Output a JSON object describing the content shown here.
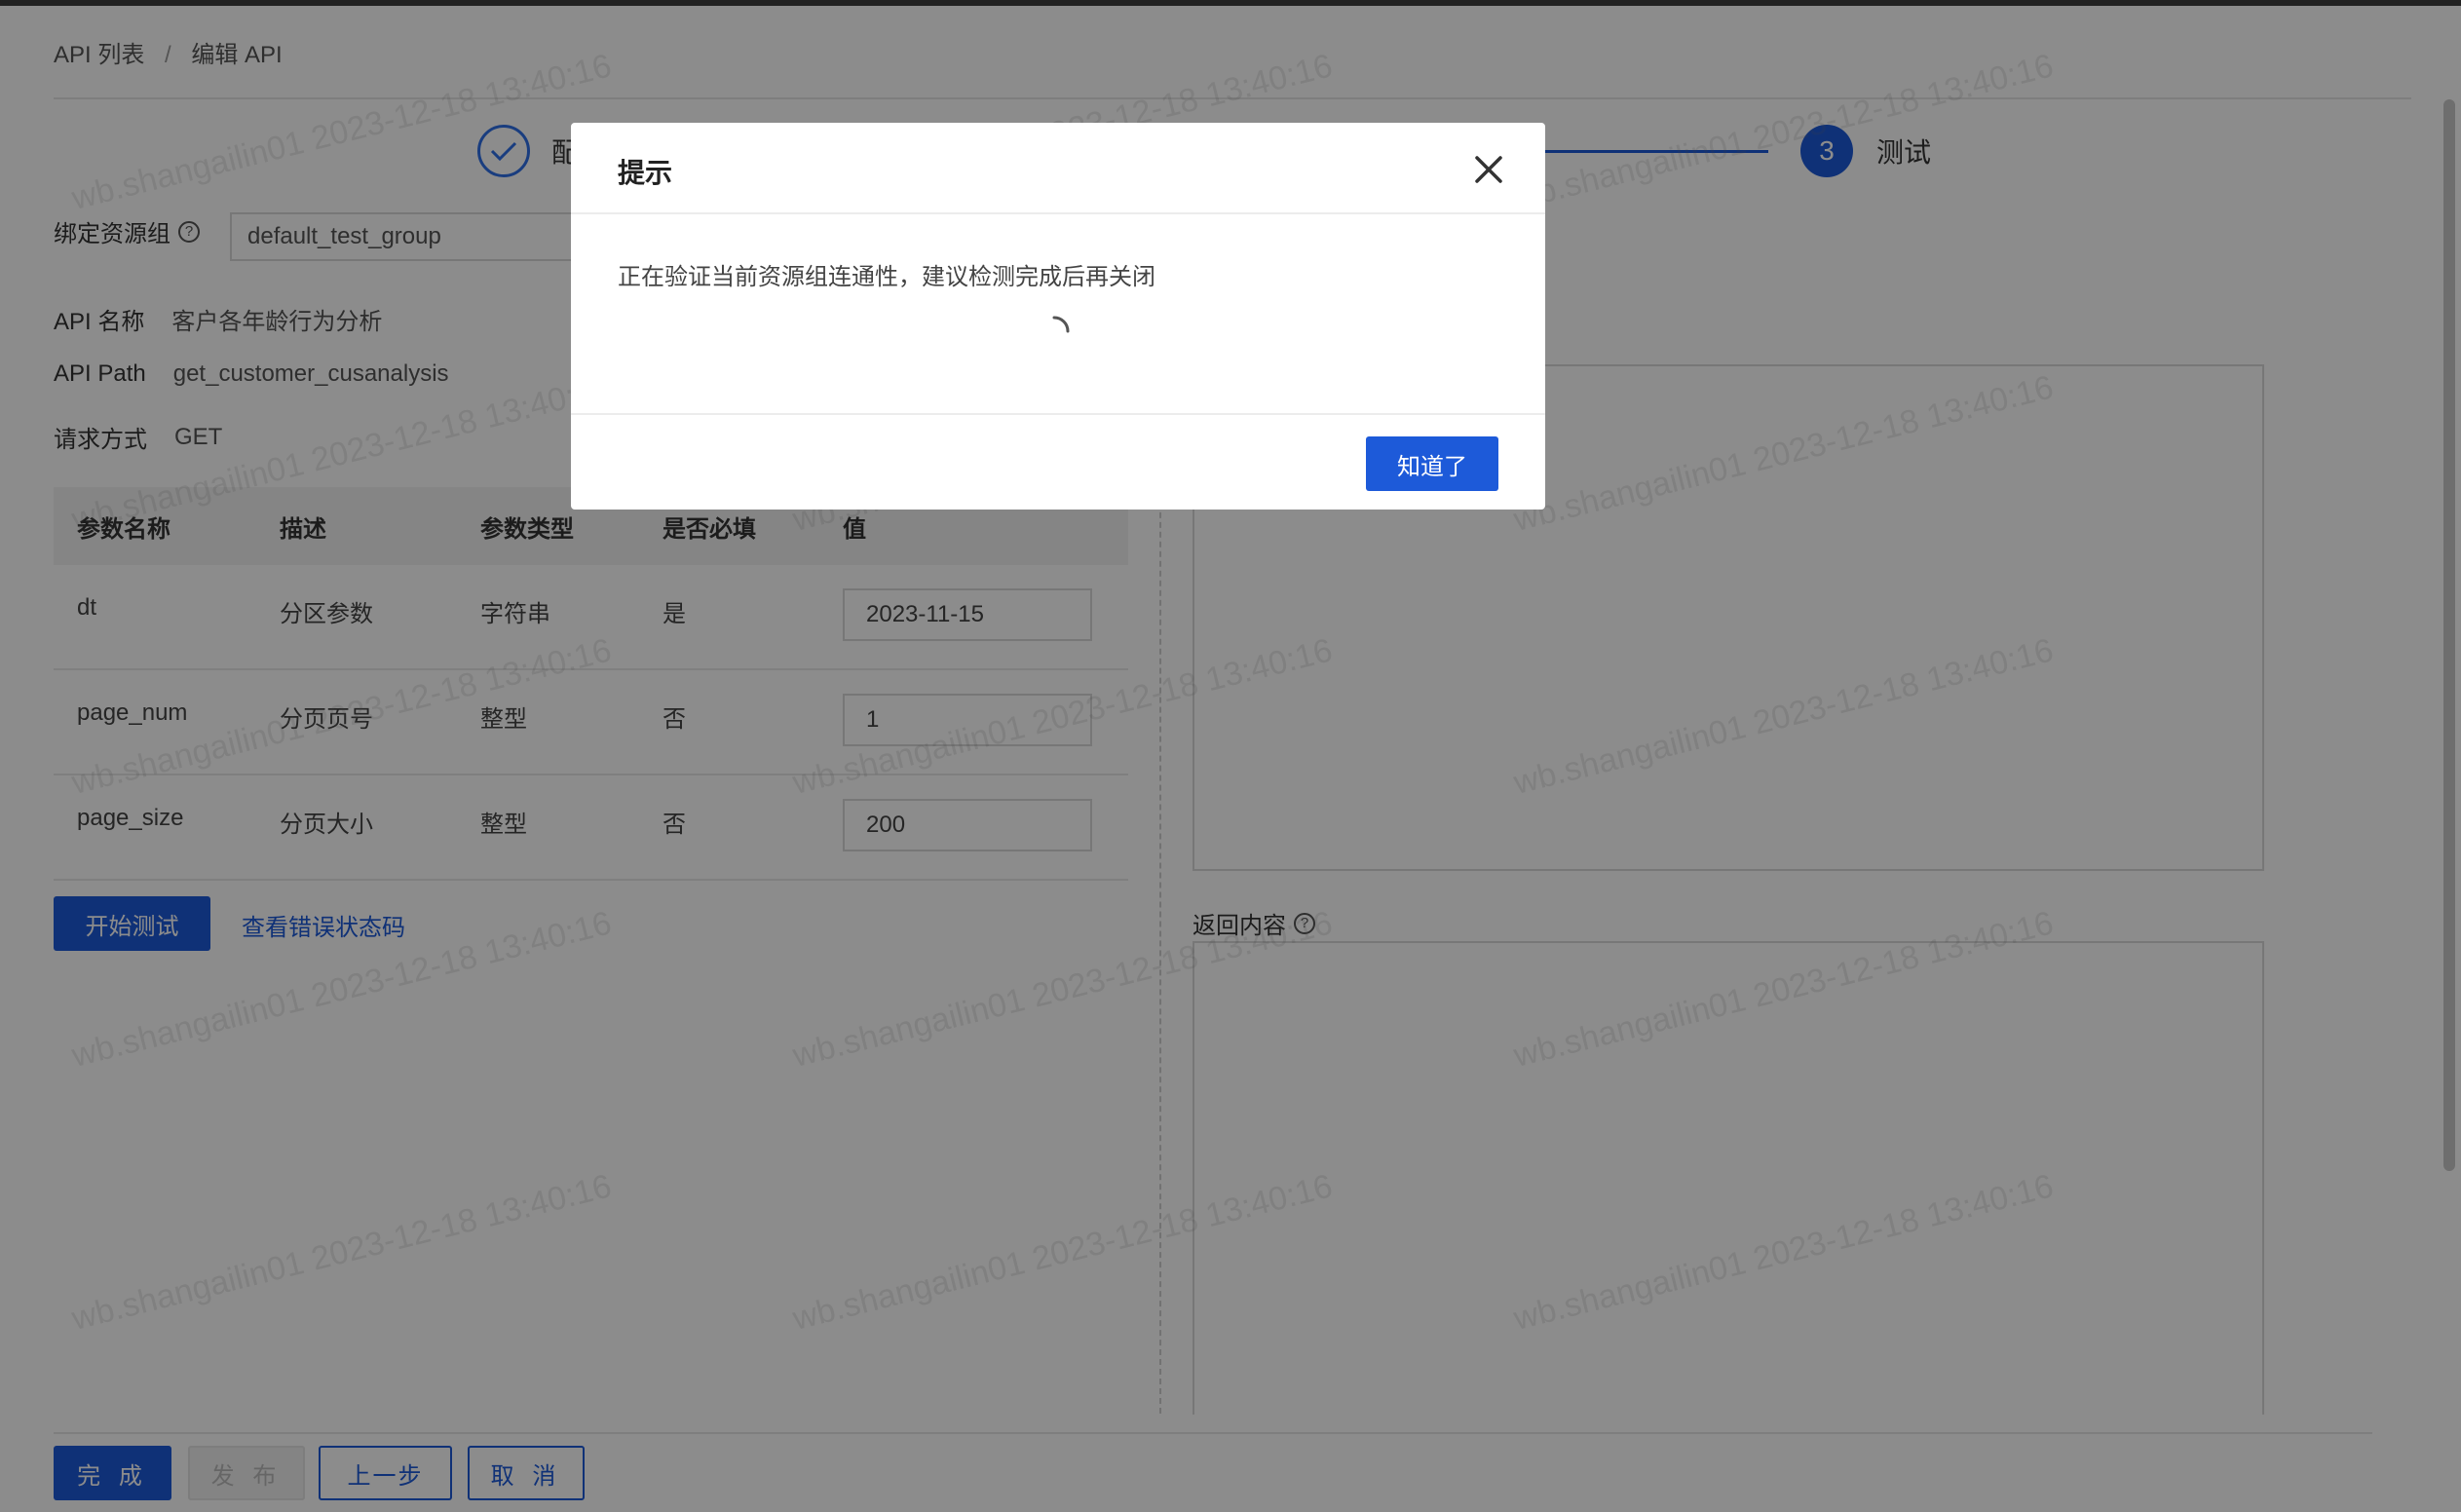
{
  "breadcrumb": {
    "items": [
      "API 列表",
      "编辑 API"
    ],
    "separator": "/"
  },
  "steps": {
    "step1": {
      "label": "配",
      "state": "done"
    },
    "step3": {
      "number": "3",
      "label": "测试",
      "state": "active"
    }
  },
  "form": {
    "resource_group_label": "绑定资源组",
    "resource_group_value": "default_test_group",
    "api_name_label": "API 名称",
    "api_name_value": "客户各年龄行为分析",
    "api_path_label": "API Path",
    "api_path_value": "get_customer_cusanalysis",
    "method_label": "请求方式",
    "method_value": "GET"
  },
  "params_table": {
    "headers": [
      "参数名称",
      "描述",
      "参数类型",
      "是否必填",
      "值"
    ],
    "rows": [
      {
        "name": "dt",
        "desc": "分区参数",
        "type": "字符串",
        "required": "是",
        "value": "2023-11-15"
      },
      {
        "name": "page_num",
        "desc": "分页页号",
        "type": "整型",
        "required": "否",
        "value": "1"
      },
      {
        "name": "page_size",
        "desc": "分页大小",
        "type": "整型",
        "required": "否",
        "value": "200"
      }
    ]
  },
  "actions": {
    "start_test": "开始测试",
    "view_error_codes": "查看错误状态码"
  },
  "return_content_label": "返回内容",
  "footer": {
    "done": "完 成",
    "publish": "发 布",
    "prev": "上一步",
    "cancel": "取 消"
  },
  "watermark": "wb.shangailin01 2023-12-18 13:40:16",
  "modal": {
    "title": "提示",
    "message": "正在验证当前资源组连通性，建议检测完成后再关闭",
    "ok_label": "知道了"
  },
  "colors": {
    "primary": "#1d5ad9",
    "overlay": "rgba(0,0,0,0.45)"
  }
}
